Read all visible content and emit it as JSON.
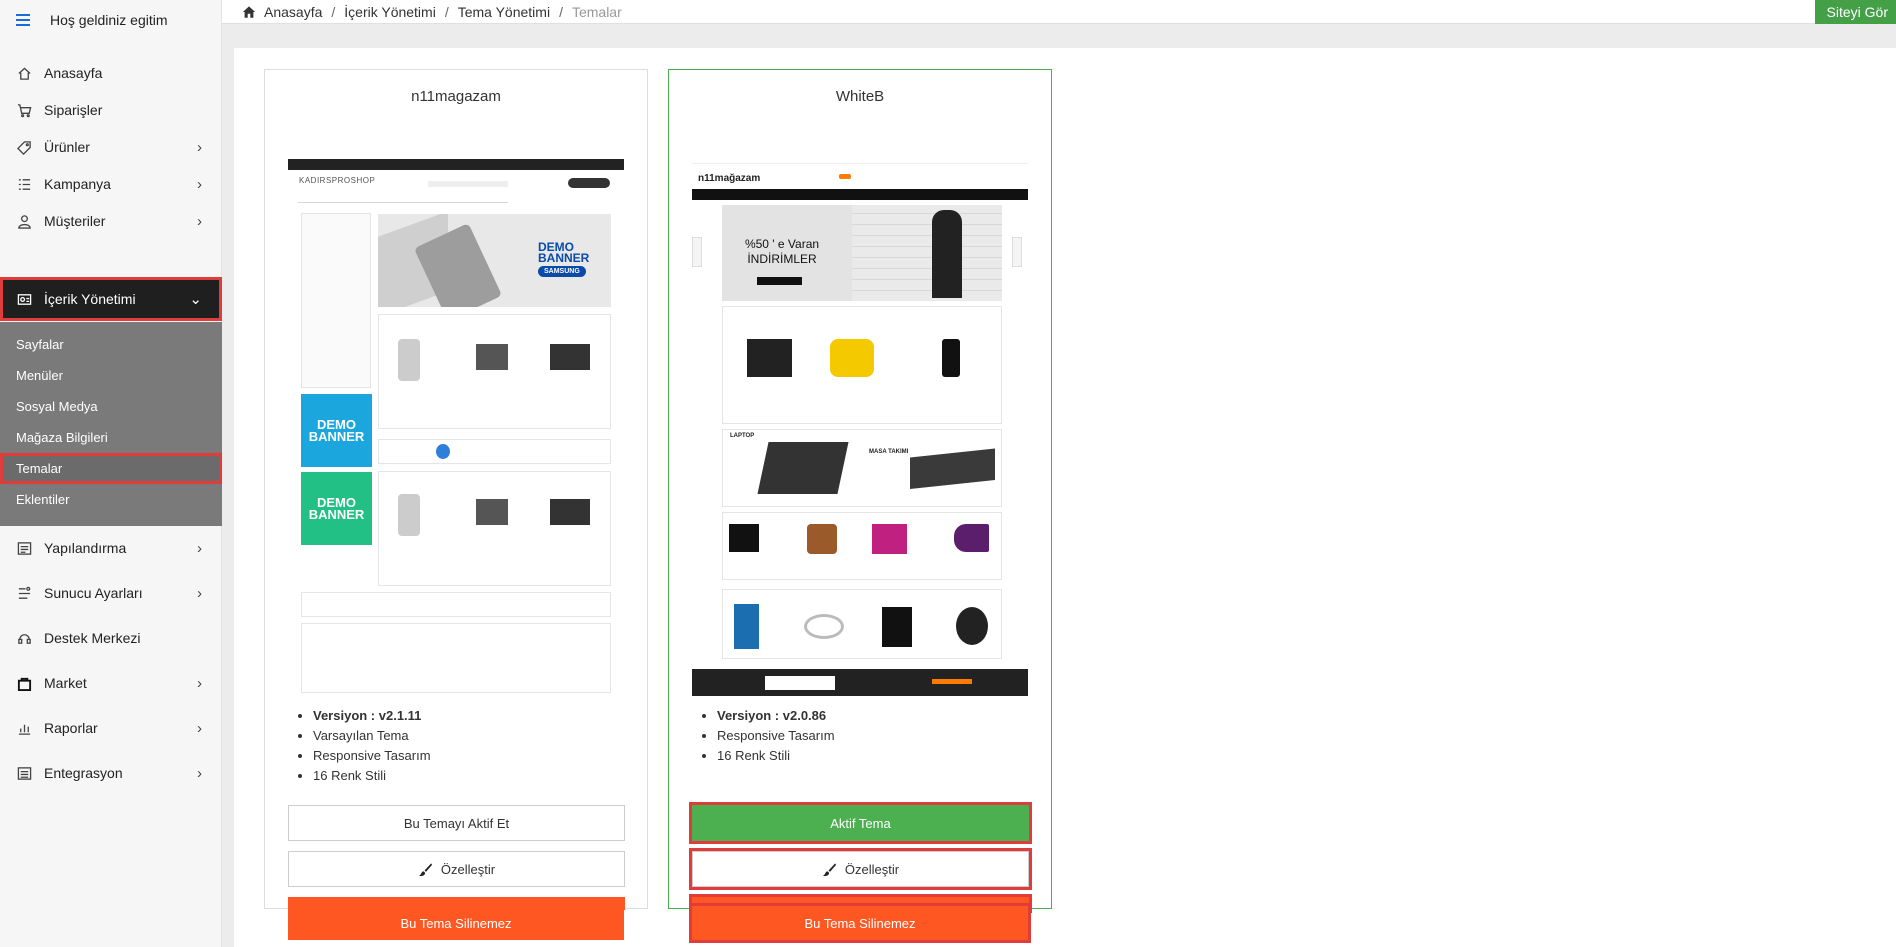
{
  "sidebar": {
    "header": "Hoş geldiniz egitim",
    "items": [
      {
        "label": "Anasayfa",
        "icon": "home-icon"
      },
      {
        "label": "Siparişler",
        "icon": "cart-icon"
      },
      {
        "label": "Ürünler",
        "icon": "tag-icon"
      },
      {
        "label": "Kampanya",
        "icon": "list-icon"
      },
      {
        "label": "Müşteriler",
        "icon": "user-icon"
      },
      {
        "label": "İçerik Yönetimi",
        "icon": "content-icon"
      },
      {
        "label": "Yapılandırma",
        "icon": "config-icon"
      },
      {
        "label": "Sunucu Ayarları",
        "icon": "server-icon"
      },
      {
        "label": "Destek Merkezi",
        "icon": "support-icon"
      },
      {
        "label": "Market",
        "icon": "bag-icon"
      },
      {
        "label": "Raporlar",
        "icon": "report-icon"
      },
      {
        "label": "Entegrasyon",
        "icon": "integration-icon"
      }
    ],
    "sub_items": [
      "Sayfalar",
      "Menüler",
      "Sosyal Medya",
      "Mağaza Bilgileri",
      "Temalar",
      "Eklentiler"
    ]
  },
  "breadcrumb": {
    "items": [
      "Anasayfa",
      "İçerik Yönetimi",
      "Tema Yönetimi"
    ],
    "current": "Temalar"
  },
  "site_button": "Siteyi Gör",
  "themes": [
    {
      "name": "n11magazam",
      "features": [
        "Versiyon : v2.1.11",
        "Varsayılan Tema",
        "Responsive Tasarım",
        "16 Renk Stili"
      ],
      "activate_label": "Bu Temayı Aktif Et",
      "customize_label": "Özelleştir",
      "delete_label": "Bu Tema Silinemez",
      "preview": {
        "logo": "KADIRSPROSHOP",
        "banner": "DEMO BANNER",
        "banner_brand": "SAMSUNG"
      }
    },
    {
      "name": "WhiteB",
      "features": [
        "Versiyon : v2.0.86",
        "Responsive Tasarım",
        "16 Renk Stili"
      ],
      "activate_label": "Aktif Tema",
      "customize_label": "Özelleştir",
      "delete_label": "Bu Tema Silinemez",
      "preview": {
        "logo": "n11mağazam",
        "hero_line1": "%50 ' e Varan",
        "hero_line2": "İNDİRİMLER",
        "section_laptop": "LAPTOP",
        "section_table": "MASA TAKIMI"
      }
    }
  ],
  "colors": {
    "active_green": "#4caf50",
    "delete_orange": "#ff5722",
    "highlight_red": "#e03c3c",
    "sidebar_active": "#1f1f1f",
    "submenu_bg": "#7a7a7a"
  }
}
